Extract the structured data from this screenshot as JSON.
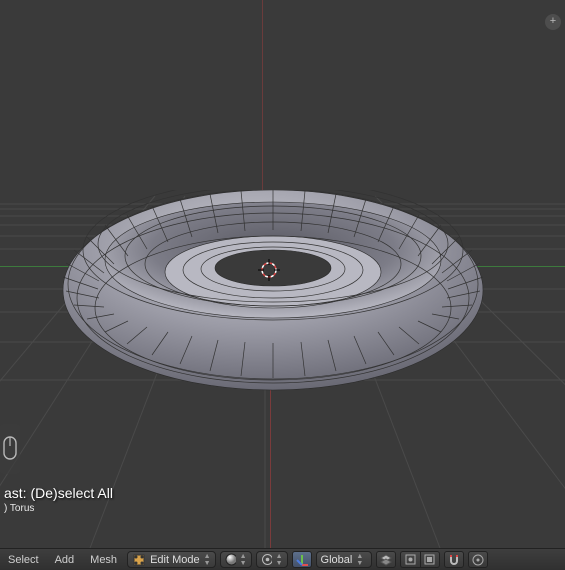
{
  "viewport": {
    "object_name": ") Torus",
    "last_operation_prefix": "ast: ",
    "last_operation_name": "(De)select All"
  },
  "header": {
    "menus": [
      "Select",
      "Add",
      "Mesh"
    ],
    "mode_label": "Edit Mode",
    "orientation_label": "Global"
  },
  "icons": {
    "viewport_toggle": "+",
    "mode_icon": "edit-mode-icon",
    "shading": "sphere-icon",
    "pivot": "pivot-icon",
    "manipulator": "axes-icon",
    "layers": "layers-icon",
    "pe_hidden": "pe-hidden-icon",
    "pe_all": "pe-all-icon",
    "snap": "magnet-icon"
  }
}
